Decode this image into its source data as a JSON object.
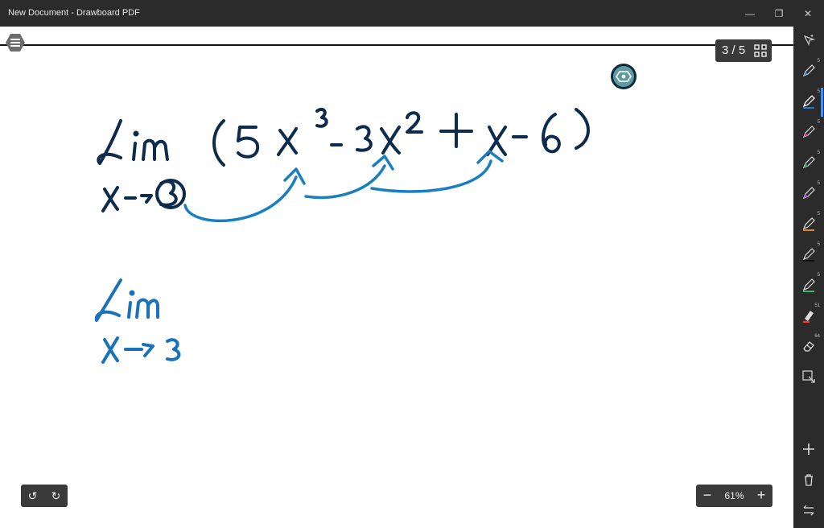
{
  "window": {
    "title": "New Document - Drawboard PDF",
    "minimize_glyph": "—",
    "restore_glyph": "❐",
    "close_glyph": "✕"
  },
  "pager": {
    "label": "3 / 5"
  },
  "history": {
    "undo_glyph": "↺",
    "redo_glyph": "↻"
  },
  "zoom": {
    "value": "61%",
    "minus": "−",
    "plus": "+"
  },
  "toolbar": {
    "tools": [
      {
        "name": "pen-1",
        "badge": "5",
        "color": "#3a8fd6"
      },
      {
        "name": "pen-2",
        "badge": "5",
        "color": "#1f7bc4"
      },
      {
        "name": "pen-3",
        "badge": "5",
        "color": "#d23a8c"
      },
      {
        "name": "pen-4",
        "badge": "5",
        "color": "#2e9b5a"
      },
      {
        "name": "pen-5",
        "badge": "5",
        "color": "#9b3ad2"
      },
      {
        "name": "pen-6",
        "badge": "5",
        "color": "#e08a1e"
      },
      {
        "name": "pen-7",
        "badge": "5",
        "color": "#222222"
      },
      {
        "name": "pen-8",
        "badge": "5",
        "color": "#2eb872"
      },
      {
        "name": "highlighter",
        "badge": "51",
        "color": "#e53935"
      },
      {
        "name": "eraser",
        "badge": "64",
        "color": "#dddddd"
      }
    ]
  },
  "colors": {
    "ink": "#0d2b4d",
    "arrow": "#1a7fc1",
    "ink2": "#1a72b8",
    "chrome": "#2b2b2b",
    "accent": "#4a90e2"
  }
}
